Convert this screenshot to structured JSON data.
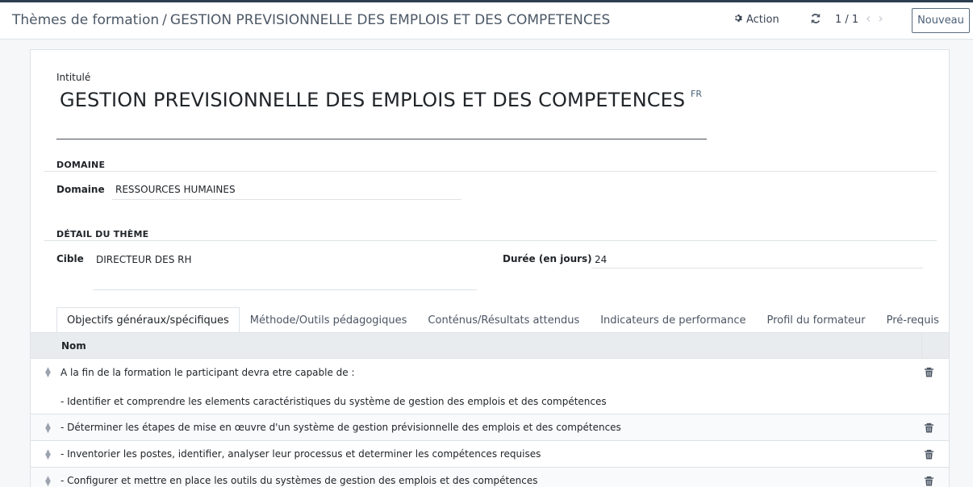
{
  "breadcrumb": {
    "parent": "Thèmes de formation",
    "separator": "/",
    "current": "GESTION PREVISIONNELLE DES EMPLOIS ET DES COMPETENCES"
  },
  "toolbar": {
    "action_label": "Action",
    "action_icon": "gear-icon",
    "refresh_icon": "refresh-icon",
    "pager_value": "1 / 1",
    "prev_icon": "chevron-left-icon",
    "next_icon": "chevron-right-icon",
    "new_label": "Nouveau"
  },
  "form": {
    "title_label": "Intitulé",
    "title_value": "GESTION PREVISIONNELLE DES EMPLOIS ET DES COMPETENCES",
    "lang_badge": "FR",
    "domain_group": "DOMAINE",
    "domain_label": "Domaine",
    "domain_value": "RESSOURCES HUMAINES",
    "detail_group": "DÉTAIL DU THÈME",
    "target_label": "Cible",
    "target_value": "DIRECTEUR DES RH",
    "duration_label": "Durée (en jours)",
    "duration_value": "24"
  },
  "tabs": [
    {
      "label": "Objectifs généraux/spécifiques",
      "active": true
    },
    {
      "label": "Méthode/Outils pédagogiques",
      "active": false
    },
    {
      "label": "Conténus/Résultats attendus",
      "active": false
    },
    {
      "label": "Indicateurs de performance",
      "active": false
    },
    {
      "label": "Profil du formateur",
      "active": false
    },
    {
      "label": "Pré-requis",
      "active": false
    }
  ],
  "table": {
    "column_header": "Nom",
    "rows": [
      {
        "line1": "A la fin de la formation le participant devra etre capable de :",
        "line2": "- Identifier et comprendre les elements caractéristiques du système de gestion des emplois et des compétences"
      },
      {
        "line1": "- Déterminer les étapes de mise en œuvre d'un système de gestion prévisionnelle des emplois et des compétences"
      },
      {
        "line1": "- Inventorier les postes, identifier, analyser leur processus et determiner les compétences requises"
      },
      {
        "line1": "- Configurer et mettre en place les outils du systèmes de gestion des emplois et des compétences"
      }
    ]
  },
  "colors": {
    "topbar": "#2c3e50",
    "header_bg": "#e9ecef",
    "accent": "#4b6078"
  }
}
